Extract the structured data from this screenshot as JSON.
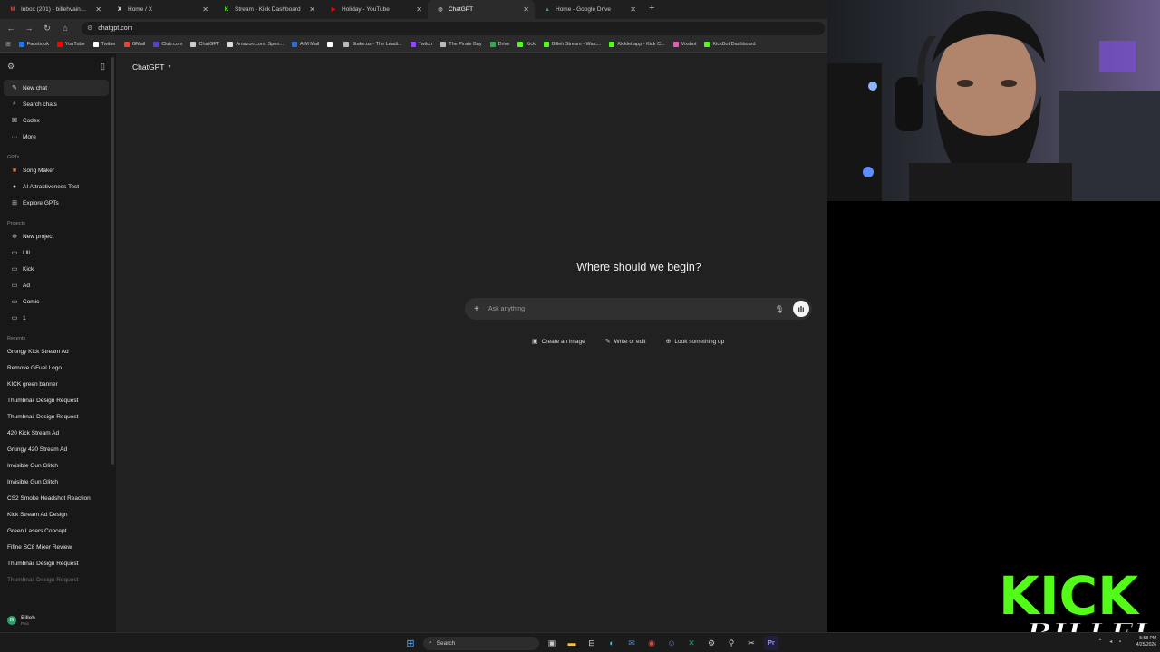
{
  "tabs": [
    {
      "title": "Inbox (201) - billehvain@gmail.com",
      "favicon": "gmail-icon",
      "color": "#ea4335",
      "glyph": "M",
      "active": false
    },
    {
      "title": "Home / X",
      "favicon": "x-icon",
      "color": "#ffffff",
      "glyph": "X",
      "active": false
    },
    {
      "title": "Stream - Kick Dashboard",
      "favicon": "kick-icon",
      "color": "#53fc18",
      "glyph": "K",
      "active": false
    },
    {
      "title": "Holiday - YouTube",
      "favicon": "youtube-icon",
      "color": "#ff0000",
      "glyph": "▶",
      "active": false
    },
    {
      "title": "ChatGPT",
      "favicon": "chatgpt-icon",
      "color": "#cccccc",
      "glyph": "◎",
      "active": true
    },
    {
      "title": "Home - Google Drive",
      "favicon": "drive-icon",
      "color": "#34a853",
      "glyph": "▲",
      "active": false
    }
  ],
  "address": {
    "url": "chatgpt.com"
  },
  "bookmarks": [
    {
      "label": "Facebook",
      "color": "#1877f2"
    },
    {
      "label": "YouTube",
      "color": "#ff0000"
    },
    {
      "label": "Twitter",
      "color": "#ffffff"
    },
    {
      "label": "GMail",
      "color": "#ea4335"
    },
    {
      "label": "Club.com",
      "color": "#5b3fd1"
    },
    {
      "label": "ChatGPT",
      "color": "#cccccc"
    },
    {
      "label": "Amazon.com. Spen...",
      "color": "#dddddd"
    },
    {
      "label": "AIM Mail",
      "color": "#2f6fd6"
    },
    {
      "label": "",
      "color": "#ffffff"
    },
    {
      "label": "Stake.us - The Leadi...",
      "color": "#bbbbbb"
    },
    {
      "label": "Twitch",
      "color": "#9146ff"
    },
    {
      "label": "The Pirate Bay",
      "color": "#bbbbbb"
    },
    {
      "label": "Drive",
      "color": "#34a853"
    },
    {
      "label": "Kick",
      "color": "#53fc18"
    },
    {
      "label": "Billeh Stream - Watc...",
      "color": "#53fc18"
    },
    {
      "label": "Kicklet.app - Kick C...",
      "color": "#53fc18"
    },
    {
      "label": "Vosbot",
      "color": "#e05fb5"
    },
    {
      "label": "KickBot Dashboard",
      "color": "#53fc18"
    }
  ],
  "sidebar": {
    "nav": [
      {
        "label": "New chat",
        "icon": "edit-icon",
        "glyph": "✎",
        "selected": true
      },
      {
        "label": "Search chats",
        "icon": "search-icon",
        "glyph": "⌕",
        "selected": false
      },
      {
        "label": "Codex",
        "icon": "codex-icon",
        "glyph": "⌘",
        "selected": false
      },
      {
        "label": "More",
        "icon": "more-icon",
        "glyph": "···",
        "selected": false
      }
    ],
    "gpts_label": "GPTs",
    "gpts": [
      {
        "label": "Song Maker",
        "icon": "song-maker-icon",
        "glyph": "■",
        "color": "#e2703a"
      },
      {
        "label": "AI Attractiveness Test",
        "icon": "ai-attractiveness-icon",
        "glyph": "●",
        "color": "#dddddd"
      },
      {
        "label": "Explore GPTs",
        "icon": "explore-icon",
        "glyph": "⊞",
        "color": "#cccccc"
      }
    ],
    "projects_label": "Projects",
    "projects": [
      {
        "label": "New project",
        "icon": "new-folder-icon",
        "glyph": "⊕"
      },
      {
        "label": "Llll",
        "icon": "folder-icon",
        "glyph": "▭"
      },
      {
        "label": "Kick",
        "icon": "folder-icon",
        "glyph": "▭"
      },
      {
        "label": "Ad",
        "icon": "folder-icon",
        "glyph": "▭"
      },
      {
        "label": "Comic",
        "icon": "folder-icon",
        "glyph": "▭"
      },
      {
        "label": "1",
        "icon": "folder-icon",
        "glyph": "▭"
      }
    ],
    "recents_label": "Recents",
    "recents": [
      "Grungy Kick Stream Ad",
      "Remove GFuel Logo",
      "KICK green banner",
      "Thumbnail Design Request",
      "Thumbnail Design Request",
      "420 Kick Stream Ad",
      "Grungy 420 Stream Ad",
      "Invisible Gun Glitch",
      "Invisible Gun Glitch",
      "CS2 Smoke Headshot Reaction",
      "Kick Stream Ad Design",
      "Green Lasers Concept",
      "Fifine SC8 Mixer Review",
      "Thumbnail Design Request",
      "Thumbnail Design Request"
    ],
    "user": {
      "name": "Billeh",
      "plan": "Plus",
      "initials": "BI"
    }
  },
  "main": {
    "model": "ChatGPT",
    "heading": "Where should we begin?",
    "composer_placeholder": "Ask anything",
    "chips": [
      {
        "label": "Create an image",
        "icon": "image-icon",
        "glyph": "▣"
      },
      {
        "label": "Write or edit",
        "icon": "pencil-icon",
        "glyph": "✎"
      },
      {
        "label": "Look something up",
        "icon": "globe-icon",
        "glyph": "⊕"
      }
    ]
  },
  "taskbar": {
    "search_label": "Search",
    "time": "5:58 PM",
    "date": "4/25/2026"
  },
  "overlay": {
    "logo_line1": "KICK",
    "logo_line2": "BILLEH",
    "logo_color": "#53fc18"
  }
}
